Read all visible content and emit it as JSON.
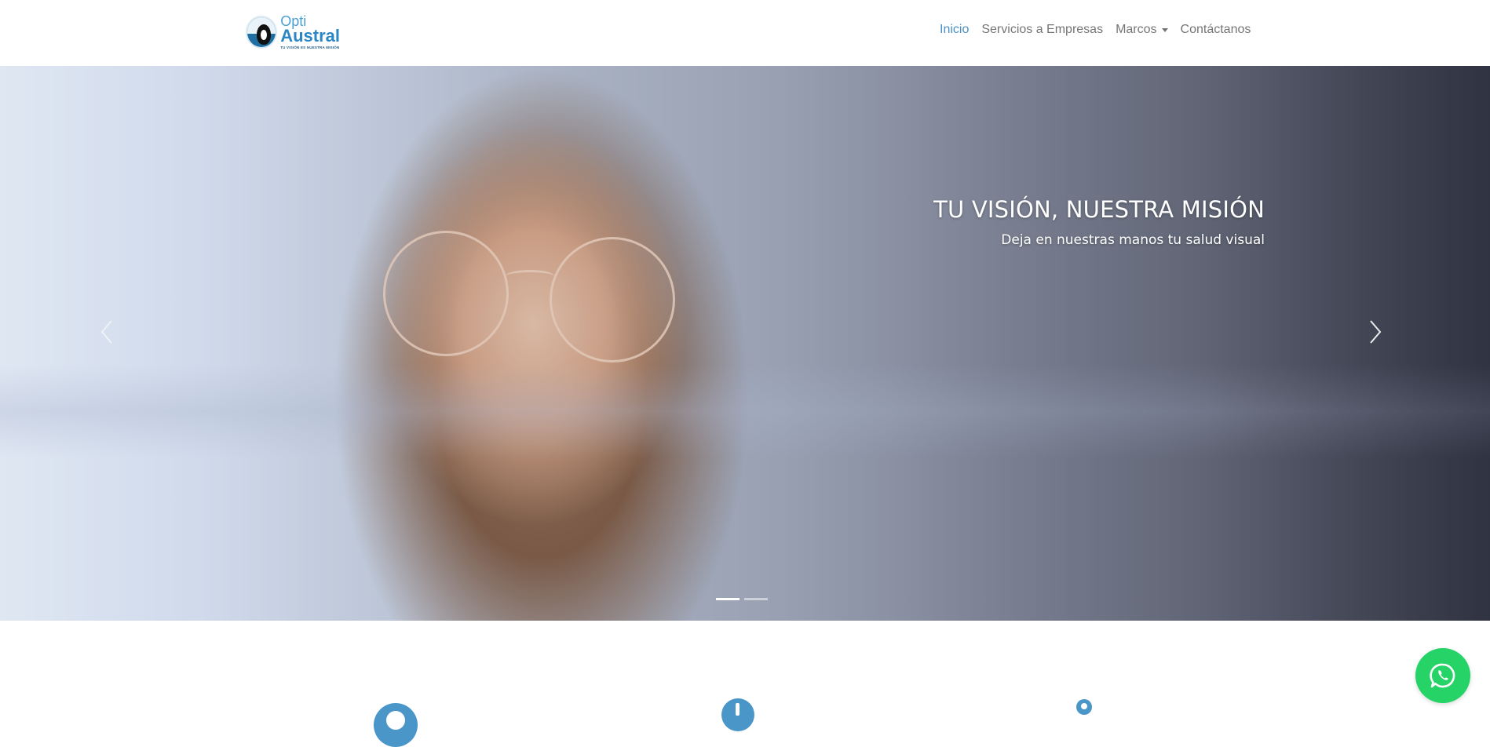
{
  "brand": {
    "name_line1": "Opti",
    "name_line2": "Austral",
    "tagline": "TU VISIÓN ES NUESTRA MISIÓN"
  },
  "nav": {
    "items": [
      {
        "label": "Inicio",
        "active": true
      },
      {
        "label": "Servicios a Empresas",
        "active": false
      },
      {
        "label": "Marcos",
        "active": false,
        "dropdown": true
      },
      {
        "label": "Contáctanos",
        "active": false
      }
    ]
  },
  "hero": {
    "title": "TU VISIÓN, NUESTRA MISIÓN",
    "subtitle": "Deja en nuestras manos tu salud visual",
    "slides_total": 2,
    "active_slide": 1
  },
  "icons": {
    "prev": "chevron-left-icon",
    "next": "chevron-right-icon",
    "whatsapp": "whatsapp-icon",
    "feature1": "eye-icon",
    "feature2": "clock-icon",
    "feature3": "location-pin-icon"
  },
  "colors": {
    "accent": "#4a90c2",
    "nav_text": "#737373",
    "whatsapp": "#25d366",
    "feature_icon": "#4a96c9"
  }
}
